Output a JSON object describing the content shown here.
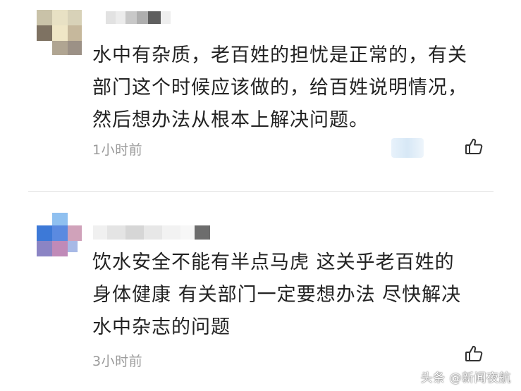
{
  "comments": [
    {
      "text_lines": [
        "水中有杂质，老百姓的担忧是正常的，有关",
        "部门这个时候应该做的，给百姓说明情况，",
        "然后想办法从根本上解决问题。"
      ],
      "time": "1小时前",
      "avatar_icon": "pixelated-avatar",
      "like_icon": "thumbs-up-icon"
    },
    {
      "text_lines": [
        "饮水安全不能有半点马虎 这关乎老百姓的",
        "身体健康 有关部门一定要想办法 尽快解决",
        "水中杂志的问题"
      ],
      "time": "3小时前",
      "avatar_icon": "pixelated-avatar",
      "like_icon": "thumbs-up-icon"
    }
  ],
  "watermark": "头条 @新闻夜航",
  "colors": {
    "text": "#222222",
    "time": "#9b9b9b",
    "divider": "#e5e5e5"
  }
}
